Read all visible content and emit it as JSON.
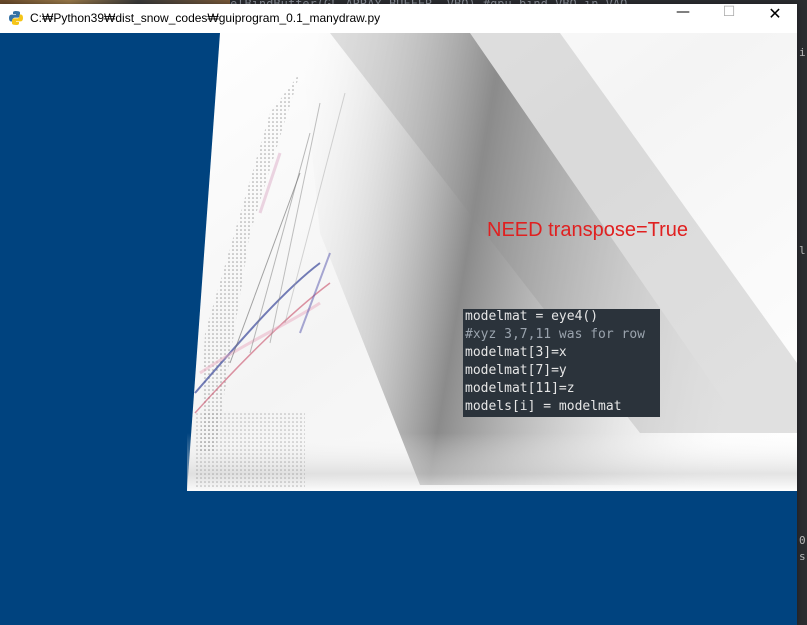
{
  "window": {
    "title": "C:₩Python39₩dist_snow_codes₩guiprogram_0.1_manydraw.py",
    "controls": {
      "minimize": "—",
      "maximize": "☐",
      "close": "✕"
    }
  },
  "background_editor": {
    "visible_code_fragment": "elBindBuffer(GL_ARRAY_BUFFER, VBO) #gpu bind VBO in VAO"
  },
  "canvas": {
    "annotation": "NEED transpose=True",
    "code_snippet": [
      "modelmat = eye4()",
      "#xyz 3,7,11 was for row",
      "modelmat[3]=x",
      "modelmat[7]=y",
      "modelmat[11]=z",
      "models[i] = modelmat"
    ],
    "colors": {
      "clear_color": "#00437f",
      "annotation_color": "#e02020",
      "code_bg": "#2b333b"
    }
  }
}
